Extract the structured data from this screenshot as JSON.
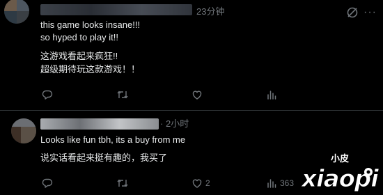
{
  "comments": [
    {
      "time": "23分钟",
      "lines": [
        "this game looks insane!!!",
        "so hyped to play it!!"
      ],
      "translation_lines": [
        "这游戏看起来疯狂!!",
        "超级期待玩这款游戏！！"
      ],
      "actions": {
        "reply_count": "",
        "repost_count": "",
        "like_count": "",
        "view_count": ""
      }
    },
    {
      "time": "2小时",
      "lines": [
        "Looks like fun tbh, its a buy from me"
      ],
      "translation_lines": [
        "说实话看起来挺有趣的，我买了"
      ],
      "actions": {
        "reply_count": "",
        "repost_count": "",
        "like_count": "2",
        "view_count": "363"
      }
    }
  ],
  "watermark": {
    "top_text": "小皮",
    "main_text": "xiaopi"
  },
  "colors": {
    "background": "#000000",
    "text": "#e7e9ea",
    "muted": "#71767b",
    "divider": "#2f3336"
  },
  "icons": [
    "reply-icon",
    "repost-icon",
    "like-icon",
    "views-icon",
    "grok-icon",
    "more-icon"
  ]
}
